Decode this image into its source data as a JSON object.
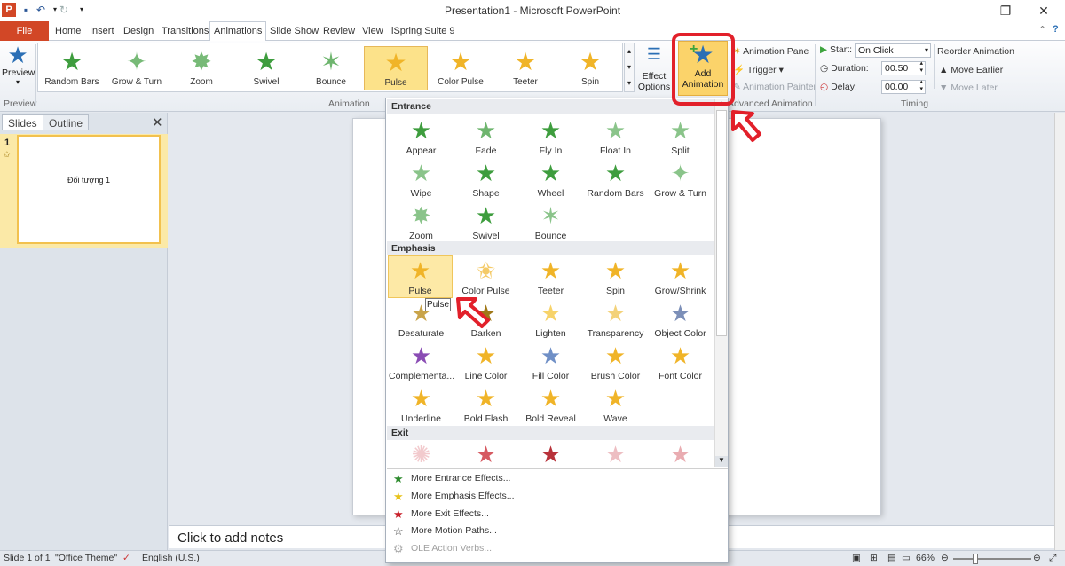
{
  "window": {
    "title": "Presentation1 - Microsoft PowerPoint"
  },
  "tabs": [
    "File",
    "Home",
    "Insert",
    "Design",
    "Transitions",
    "Animations",
    "Slide Show",
    "Review",
    "View",
    "iSpring Suite 9"
  ],
  "ribbon": {
    "preview_label": "Preview",
    "preview_group": "Preview",
    "gallery": [
      {
        "label": "Random Bars",
        "icon": "random-bars-icon"
      },
      {
        "label": "Grow & Turn",
        "icon": "grow-turn-icon"
      },
      {
        "label": "Zoom",
        "icon": "zoom-icon"
      },
      {
        "label": "Swivel",
        "icon": "swivel-icon"
      },
      {
        "label": "Bounce",
        "icon": "bounce-icon"
      },
      {
        "label": "Pulse",
        "icon": "pulse-icon"
      },
      {
        "label": "Color Pulse",
        "icon": "color-pulse-icon"
      },
      {
        "label": "Teeter",
        "icon": "teeter-icon"
      },
      {
        "label": "Spin",
        "icon": "spin-icon"
      }
    ],
    "animation_group": "Animation",
    "effect_options_1": "Effect",
    "effect_options_2": "Options",
    "add_animation_1": "Add",
    "add_animation_2": "Animation",
    "animation_pane": "Animation Pane",
    "trigger": "Trigger",
    "animation_painter": "Animation Painter",
    "advanced_group": "Advanced Animation",
    "start_label": "Start:",
    "start_value": "On Click",
    "duration_label": "Duration:",
    "duration_value": "00.50",
    "delay_label": "Delay:",
    "delay_value": "00.00",
    "reorder": "Reorder Animation",
    "move_earlier": "Move Earlier",
    "move_later": "Move Later",
    "timing_group": "Timing"
  },
  "leftpane": {
    "tab_slides": "Slides",
    "tab_outline": "Outline",
    "slide_number": "1",
    "thumb_text": "Đối tượng 1"
  },
  "notes": "Click to add notes",
  "status": {
    "slide": "Slide 1 of 1",
    "theme": "\"Office Theme\"",
    "language": "English (U.S.)",
    "zoom": "66%"
  },
  "dropdown": {
    "entrance_title": "Entrance",
    "entrance": [
      "Appear",
      "Fade",
      "Fly In",
      "Float In",
      "Split",
      "Wipe",
      "Shape",
      "Wheel",
      "Random Bars",
      "Grow & Turn",
      "Zoom",
      "Swivel",
      "Bounce"
    ],
    "emphasis_title": "Emphasis",
    "emphasis": [
      "Pulse",
      "Color Pulse",
      "Teeter",
      "Spin",
      "Grow/Shrink",
      "Desaturate",
      "Darken",
      "Lighten",
      "Transparency",
      "Object Color",
      "Complementa...",
      "Line Color",
      "Fill Color",
      "Brush Color",
      "Font Color",
      "Underline",
      "Bold Flash",
      "Bold Reveal",
      "Wave"
    ],
    "exit_title": "Exit",
    "more_entrance": "More Entrance Effects...",
    "more_emphasis": "More Emphasis Effects...",
    "more_exit": "More Exit Effects...",
    "more_motion": "More Motion Paths...",
    "ole_verbs": "OLE Action Verbs...",
    "tooltip": "Pulse"
  },
  "colors": {
    "accent": "#d24726",
    "highlight": "#fce28a",
    "annotation": "#e2202a",
    "entrance": "#3e9d3e",
    "emphasis": "#f0b428",
    "exit": "#c8323a"
  }
}
